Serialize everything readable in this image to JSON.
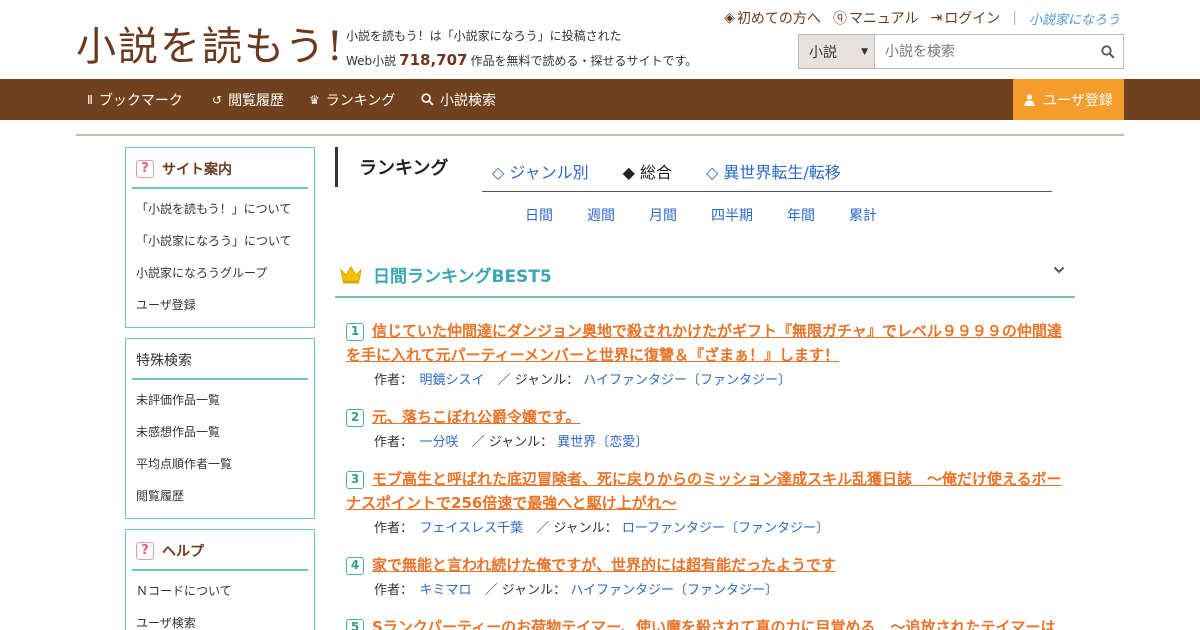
{
  "header": {
    "logo": "小説を読もう!",
    "tagline_line1": "小説を読もう！は「小説家になろう」に投稿された",
    "tagline_prefix": "Web小説",
    "work_count": "718,707",
    "tagline_suffix": "作品を無料で読める・探せるサイトです。",
    "links": {
      "first_time": "初めての方へ",
      "manual": "マニュアル",
      "login": "ログイン",
      "narou": "小説家になろう"
    },
    "search": {
      "category": "小説",
      "placeholder": "小説を検索"
    }
  },
  "nav": {
    "bookmark": "ブックマーク",
    "history": "閲覧履歴",
    "ranking": "ランキング",
    "search": "小説検索",
    "register": "ユーザ登録"
  },
  "sidebar": {
    "site_guide": {
      "title": "サイト案内",
      "items": [
        "「小説を読もう！」について",
        "「小説家になろう」について",
        "小説家になろうグループ",
        "ユーザ登録"
      ]
    },
    "special_search": {
      "title": "特殊検索",
      "items": [
        "未評価作品一覧",
        "未感想作品一覧",
        "平均点順作者一覧",
        "閲覧履歴"
      ]
    },
    "help": {
      "title": "ヘルプ",
      "items": [
        "Ｎコードについて",
        "ユーザ検索"
      ]
    }
  },
  "ranking": {
    "heading": "ランキング",
    "tabs": [
      "◇ ジャンル別",
      "◆ 総合",
      "◇ 異世界転生/転移"
    ],
    "periods": [
      "日間",
      "週間",
      "月間",
      "四半期",
      "年間",
      "累計"
    ],
    "best_title": "日間ランキングBEST5",
    "author_label": "作者：",
    "genre_label": "ジャンル：",
    "sep": "／",
    "entries": [
      {
        "rank": "1",
        "title": "信じていた仲間達にダンジョン奥地で殺されかけたがギフト『無限ガチャ』でレベル９９９９の仲間達を手に入れて元パーティーメンバーと世界に復讐＆『ざまぁ！』します！",
        "author": "明鏡シスイ",
        "genre": "ハイファンタジー〔ファンタジー〕"
      },
      {
        "rank": "2",
        "title": "元、落ちこぼれ公爵令嬢です。",
        "author": "一分咲",
        "genre": "異世界〔恋愛〕"
      },
      {
        "rank": "3",
        "title": "モブ高生と呼ばれた底辺冒険者、死に戻りからのミッション達成スキル乱獲日誌　～俺だけ使えるボーナスポイントで256倍速で最強へと駆け上がれ～",
        "author": "フェイスレス千葉",
        "genre": "ローファンタジー〔ファンタジー〕"
      },
      {
        "rank": "4",
        "title": "家で無能と言われ続けた俺ですが、世界的には超有能だったようです",
        "author": "キミマロ",
        "genre": "ハイファンタジー〔ファンタジー〕"
      },
      {
        "rank": "5",
        "title": "Sランクパーティーのお荷物テイマー、使い魔を殺されて真の力に目覚める　～追放されたテイマーは"
      }
    ]
  },
  "colors": {
    "brand_brown": "#70401f",
    "register_orange": "#f49c2c",
    "accent_teal": "#6fc4c4",
    "title_orange": "#e8742a",
    "link_blue": "#2a6ac8"
  }
}
